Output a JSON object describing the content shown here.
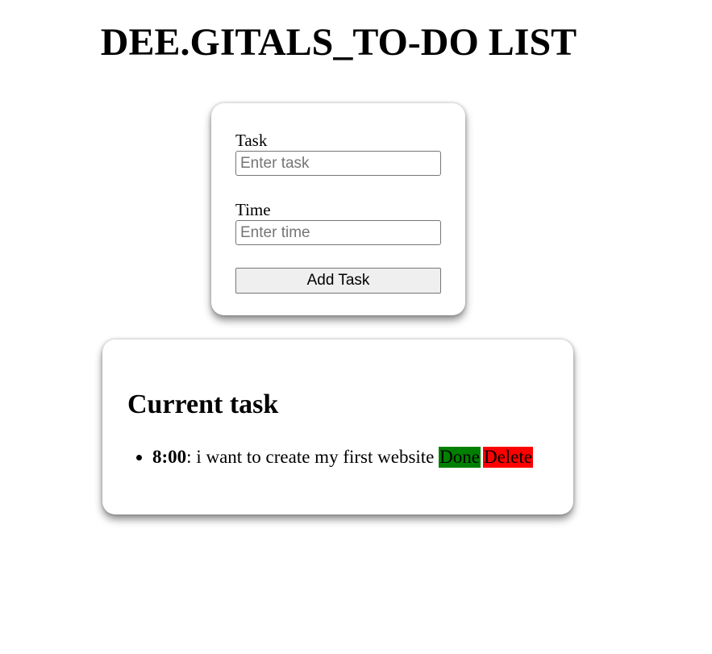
{
  "page": {
    "title": "DEE.GITALS_TO-DO LIST"
  },
  "form": {
    "task_label": "Task",
    "task_placeholder": "Enter task",
    "task_value": "",
    "time_label": "Time",
    "time_placeholder": "Enter time",
    "time_value": "",
    "add_button_label": "Add Task"
  },
  "tasks": {
    "heading": "Current task",
    "items": [
      {
        "time": "8:00",
        "separator": ":",
        "text": "i want to create my first website",
        "done_label": "Done",
        "delete_label": "Delete"
      }
    ]
  },
  "colors": {
    "done_button": "#008000",
    "delete_button": "#ff0000",
    "background": "#ffffff"
  }
}
